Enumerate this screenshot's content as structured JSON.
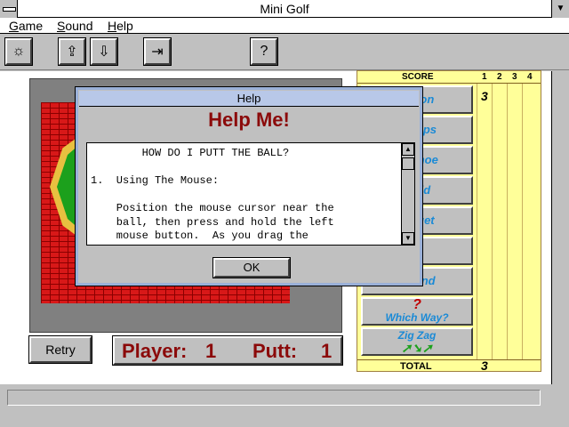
{
  "window": {
    "title": "Mini Golf",
    "restore_glyph": "▼"
  },
  "menu": [
    "Game",
    "Sound",
    "Help"
  ],
  "toolbar": {
    "buttons": [
      {
        "name": "sun-icon",
        "glyph": "☼"
      },
      {
        "name": "save-icon",
        "glyph": "⇪"
      },
      {
        "name": "load-icon",
        "glyph": "⇩"
      },
      {
        "name": "exit-door-icon",
        "glyph": "⇥"
      },
      {
        "name": "help-icon",
        "glyph": "?"
      }
    ]
  },
  "game": {
    "retry_label": "Retry",
    "player_label": "Player:",
    "player_value": "1",
    "putt_label": "Putt:",
    "putt_value": "1"
  },
  "scorecard": {
    "header": "SCORE",
    "columns": [
      "1",
      "2",
      "3",
      "4"
    ],
    "holes": [
      {
        "label": "Vision",
        "icon": ""
      },
      {
        "label": "Humps",
        "icon": ""
      },
      {
        "label": "Uhshoe",
        "icon": ""
      },
      {
        "label": "Field",
        "icon": ""
      },
      {
        "label": "Target",
        "icon": ""
      },
      {
        "label": "",
        "icon": ""
      },
      {
        "label": "Round",
        "icon": ""
      },
      {
        "label": "Which Way?",
        "icon": "?"
      },
      {
        "label": "Zig Zag",
        "icon": "➚➘➚"
      }
    ],
    "first_score": "3",
    "total_label": "TOTAL",
    "total_value": "3"
  },
  "help_dialog": {
    "title": "Help",
    "heading": "Help Me!",
    "body": "        HOW DO I PUTT THE BALL?\n\n1.  Using The Mouse:\n\n    Position the mouse cursor near the\n    ball, then press and hold the left\n    mouse button.  As you drag the",
    "scroll_up": "▲",
    "scroll_down": "▼",
    "ok_label": "OK"
  },
  "colors": {
    "accent_red": "#8b0a0a",
    "course_brick": "#d81818",
    "green": "#1ca01c",
    "scorecard_bg": "#ffff99",
    "hole_label": "#1a8ad6"
  }
}
